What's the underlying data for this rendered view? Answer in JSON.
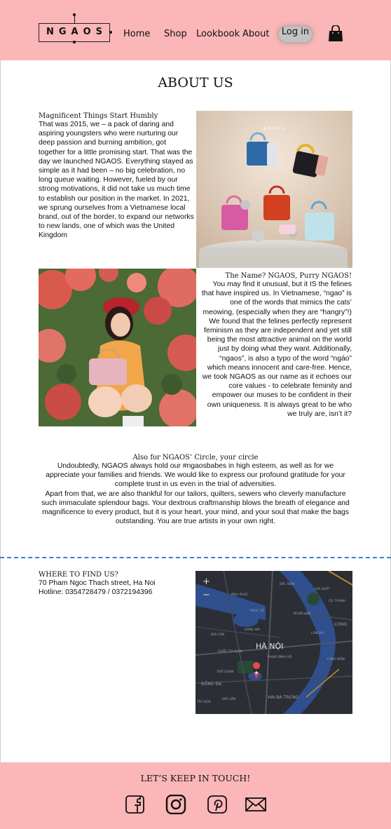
{
  "header": {
    "logo": "NGAOS",
    "nav": [
      "Home",
      "Shop",
      "Lookbook",
      "About"
    ],
    "login_label": "Log in",
    "cart_icon": "shopping-bag-icon"
  },
  "about": {
    "title": "ABOUT US",
    "section1": {
      "heading": "Magnificent Things Start Humbly",
      "text": "That was 2015, we – a pack of daring and aspiring youngsters who were nurturing our deep passion and burning ambition, got together for a little promising start. That was the day we launched NGAOS. Everything stayed as simple as it had been – no big celebration, no long queue waiting. However, fueled by our strong motivations, it did not take us much time to establish our position in the market. In 2021, we sprung ourselves from a Vietnamese local brand, out of the border, to expand our networks to new lands, one of which was the United Kingdom"
    },
    "section2": {
      "heading": "The Name? NGAOS, Purry NGAOS!",
      "text": "You may find it unusual, but it IS the felines that have inspired us. In Vietnamese, “ngao” is one of the words that mimics the cats’ meowing, (especially when they are “hangry”!) We found that the felines perfectly represent feminism as they are independent and yet still being the most attractive animal on the world just by doing what they want. Additionally, “ngaos”, is also a typo of the word “ngáo” which means innocent and care-free. Hence, we took NGAOS as our name as it echoes our core values - to celebrate feminity and empower our muses to be confident in their own uniqueness. It is always great to be who we truly are, isn’t it?"
    },
    "section3": {
      "heading": "Also for NGAOS’ Circle, your circle",
      "text1": "Undoubtedly, NGAOS always hold our #ngaosbabes in high esteem, as well as for we appreciate your families and friends. We would like to express our profound gratitude for your complete trust in us even in the trial of adversities.",
      "text2": "Apart from that, we are also thankful for our tailors, quilters, sewers who cleverly manufacture such immaculate splendour bags. Your dextrous craftmanship blows the breath of elegance and magnificence to every product, but it is your heart, your mind, and your soul that make the bags outstanding. You are true artists in your own right."
    },
    "bags_image_logo": "NGAOS"
  },
  "location": {
    "heading": "WHERE TO FIND US?",
    "address": "70 Pham Ngoc Thach street, Ha Noi",
    "hotline": "Hotline: 0354728479 / 0372194396",
    "map": {
      "zoom_in": "+",
      "zoom_out": "−",
      "city": "HÀ NỘI",
      "labels": [
        "BẮC BIÊN",
        "GIA QUẤT",
        "VĨNH PHÚC",
        "PHÚC XÁ",
        "NGỌC LÂM",
        "CỰ THÀNH",
        "LONG",
        "ĐỘI CẤN",
        "HÀNG MÃ",
        "LÂM DU",
        "QUỐC TỬ GIÁM",
        "PHẠM ĐÌNH HỒ",
        "LONG BIÊN",
        "THỔ QUAN",
        "ĐỐNG ĐA",
        "KIM LIÊN",
        "HAI BÀ TRƯNG",
        "TÂY SƠN"
      ]
    }
  },
  "footer": {
    "title": "LET’S KEEP IN TOUCH!",
    "social": [
      "facebook-icon",
      "instagram-icon",
      "pinterest-icon",
      "mail-icon"
    ]
  },
  "colors": {
    "brand_pink": "#fbb6b7",
    "divider_blue": "#3b7de0",
    "login_grey": "#c3c3c3"
  }
}
